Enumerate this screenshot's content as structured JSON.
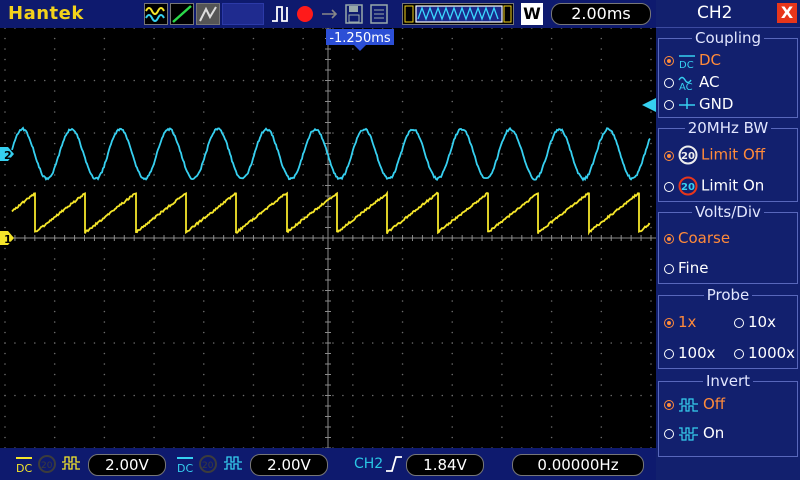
{
  "app": {
    "brand": "Hantek"
  },
  "topbar": {
    "timebase": "2.00ms",
    "waveform_mode_label": "W",
    "trigger_position": "-1.250ms"
  },
  "channel_markers": {
    "ch1": "1",
    "ch2": "2"
  },
  "bottombar": {
    "ch1_volts": "2.00V",
    "ch2_volts": "2.00V",
    "trigger_source": "CH2",
    "trigger_level": "1.84V",
    "frequency": "0.00000Hz"
  },
  "panel": {
    "title": "CH2",
    "close_label": "X",
    "coupling": {
      "title": "Coupling",
      "options": [
        "DC",
        "AC",
        "GND"
      ],
      "selected": "DC"
    },
    "bandwidth": {
      "title": "20MHz BW",
      "options": [
        "Limit Off",
        "Limit On"
      ],
      "icon_text": "20",
      "selected": "Limit Off"
    },
    "volts_div": {
      "title": "Volts/Div",
      "options": [
        "Coarse",
        "Fine"
      ],
      "selected": "Coarse"
    },
    "probe": {
      "title": "Probe",
      "options": [
        "1x",
        "10x",
        "100x",
        "1000x"
      ],
      "selected": "1x"
    },
    "invert": {
      "title": "Invert",
      "options": [
        "Off",
        "On"
      ],
      "selected": "Off"
    }
  },
  "colors": {
    "ch1": "#f5e62a",
    "ch2": "#36d0f0",
    "selected": "#ff8a3a",
    "panel_bg": "#12206e",
    "bar_bg": "#0e1a6e"
  },
  "waveforms": {
    "ch1": {
      "shape": "sawtooth",
      "cycles_on_screen": 12.8,
      "amplitude_div": 0.75,
      "offset_div": 0.1
    },
    "ch2": {
      "shape": "sine",
      "cycles_on_screen": 13.2,
      "amplitude_div": 0.95,
      "offset_div": 1.6
    }
  }
}
